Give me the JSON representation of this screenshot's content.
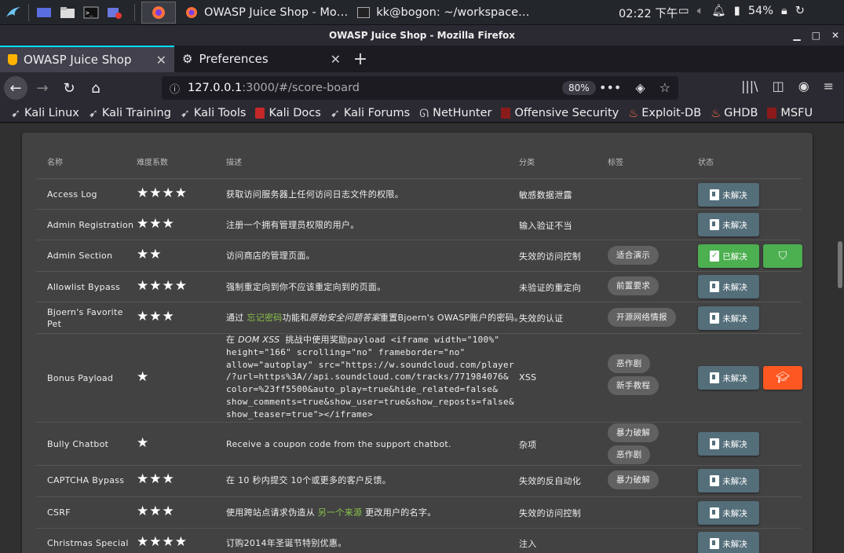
{
  "taskbar": {
    "clock": "02:22 下午",
    "battery": "54%",
    "tasks": [
      {
        "label": "OWASP Juice Shop - Mo…"
      },
      {
        "label": "kk@bogon: ~/workspace…"
      }
    ]
  },
  "window": {
    "title": "OWASP Juice Shop - Mozilla Firefox"
  },
  "tabs": [
    {
      "label": "OWASP Juice Shop"
    },
    {
      "label": "Preferences"
    }
  ],
  "navbar": {
    "url_host": "127.0.0.1",
    "url_rest": ":3000/#/score-board",
    "zoom": "80%"
  },
  "bookmarks": [
    {
      "label": "Kali Linux"
    },
    {
      "label": "Kali Training"
    },
    {
      "label": "Kali Tools"
    },
    {
      "label": "Kali Docs"
    },
    {
      "label": "Kali Forums"
    },
    {
      "label": "NetHunter"
    },
    {
      "label": "Offensive Security"
    },
    {
      "label": "Exploit-DB"
    },
    {
      "label": "GHDB"
    },
    {
      "label": "MSFU"
    }
  ],
  "table": {
    "headers": {
      "name": "名称",
      "difficulty": "难度系数",
      "description": "描述",
      "category": "分类",
      "tags": "标签",
      "status": "状态"
    },
    "rows": [
      {
        "name": "Access Log",
        "stars": "★★★★",
        "description": "获取访问服务器上任何访问日志文件的权限。",
        "category": "敏感数据泄露",
        "status": "未解决"
      },
      {
        "name": "Admin Registration",
        "stars": "★★★",
        "description": "注册一个拥有管理员权限的用户。",
        "category": "输入验证不当",
        "status": "未解决"
      },
      {
        "name": "Admin Section",
        "stars": "★★",
        "description": "访问商店的管理页面。",
        "category": "失效的访问控制",
        "tag1": "适合演示",
        "status": "已解决"
      },
      {
        "name": "Allowlist Bypass",
        "stars": "★★★★",
        "description": "强制重定向到你不应该重定向到的页面。",
        "category": "未验证的重定向",
        "tag1": "前置要求",
        "status": "未解决"
      },
      {
        "name_l1": "Bjoern's Favorite",
        "name_l2": "Pet",
        "stars": "★★★",
        "desc_pre": "通过 ",
        "desc_link": "忘记密码",
        "desc_mid": "功能和",
        "desc_em": "原始安全问题答案",
        "desc_post": "重置Bjoern's OWASP账户的密码。",
        "category": "失效的认证",
        "tag1": "开源网络情报",
        "status": "未解决"
      },
      {
        "name": "Bonus Payload",
        "stars": "★",
        "desc_l1_pre": "在 ",
        "desc_l1_em": "DOM XSS",
        "desc_l1_post": " 挑战中使用奖励payload <iframe width=\"100%\"",
        "desc_l2": "height=\"166\" scrolling=\"no\" frameborder=\"no\"",
        "desc_l3": "allow=\"autoplay\" src=\"https://w.soundcloud.com/player",
        "desc_l4": "/?url=https%3A//api.soundcloud.com/tracks/771984076&",
        "desc_l5": "color=%23ff5500&auto_play=true&hide_related=false&",
        "desc_l6": "show_comments=true&show_user=true&show_reposts=false&",
        "desc_l7": "show_teaser=true\"></iframe>",
        "category": "XSS",
        "tag1": "恶作剧",
        "tag2": "新手教程",
        "status": "未解决"
      },
      {
        "name": "Bully Chatbot",
        "stars": "★",
        "description": "Receive a coupon code from the support chatbot.",
        "category": "杂项",
        "tag1": "暴力破解",
        "tag2": "恶作剧",
        "status": "未解决"
      },
      {
        "name": "CAPTCHA Bypass",
        "stars": "★★★",
        "description": "在 10 秒内提交 10个或更多的客户反馈。",
        "category": "失效的反自动化",
        "tag1": "暴力破解",
        "status": "未解决"
      },
      {
        "name": "CSRF",
        "stars": "★★★",
        "desc_pre": "使用跨站点请求伪造从 ",
        "desc_link": "另一个来源",
        "desc_post": " 更改用户的名字。",
        "category": "失效的访问控制",
        "status": "未解决"
      },
      {
        "name": "Christmas Special",
        "stars": "★★★★",
        "description": "订购2014年圣诞节特别优惠。",
        "category": "注入",
        "status": "未解决"
      }
    ]
  }
}
